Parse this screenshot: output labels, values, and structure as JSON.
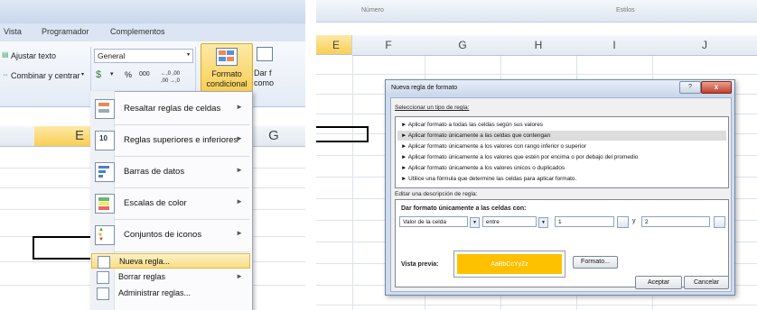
{
  "left": {
    "tabs": [
      "Vista",
      "Programador",
      "Complementos"
    ],
    "ribbon": {
      "wrap_text": "Ajustar texto",
      "merge_center": "Combinar y centrar",
      "number_format": "General",
      "percent": "%",
      "thousands": "000",
      "dec_inc": "←,0 ,00",
      "dec_dec": ",00 →,0",
      "conditional_format": [
        "Formato",
        "condicional"
      ],
      "format_as_table_partial": [
        "Dar f",
        "como"
      ]
    },
    "columns": [
      "E",
      "G"
    ],
    "menu": {
      "items": [
        {
          "label": "Resaltar reglas de celdas",
          "icon": "highlight-cells-rules-icon",
          "submenu": true
        },
        {
          "label": "Reglas superiores e inferiores",
          "icon": "top-bottom-rules-icon",
          "submenu": true
        },
        {
          "label": "Barras de datos",
          "icon": "data-bars-icon",
          "submenu": true
        },
        {
          "label": "Escalas de color",
          "icon": "color-scales-icon",
          "submenu": true
        },
        {
          "label": "Conjuntos de iconos",
          "icon": "icon-sets-icon",
          "submenu": true
        }
      ],
      "small_items": [
        {
          "label": "Nueva regla...",
          "icon": "new-rule-icon",
          "submenu": false
        },
        {
          "label": "Borrar reglas",
          "icon": "clear-rules-icon",
          "submenu": true
        },
        {
          "label": "Administrar reglas...",
          "icon": "manage-rules-icon",
          "submenu": false
        }
      ]
    }
  },
  "right": {
    "top_labels": [
      "Número",
      "Estilos"
    ],
    "columns": [
      "E",
      "F",
      "G",
      "H",
      "I",
      "J"
    ],
    "dialog": {
      "title": "Nueva regla de formato",
      "select_type_label": "Seleccionar un tipo de regla:",
      "rule_types": [
        "► Aplicar formato a todas las celdas según sus valores",
        "► Aplicar formato únicamente a las celdas que contengan",
        "► Aplicar formato únicamente a los valores con rango inferior o superior",
        "► Aplicar formato únicamente a los valores que estén por encima o por debajo del promedio",
        "► Aplicar formato únicamente a los valores únicos o duplicados",
        "► Utilice una fórmula que determine las celdas para aplicar formato."
      ],
      "selected_rule_index": 1,
      "edit_desc_label": "Editar una descripción de regla:",
      "format_only_label": "Dar formato únicamente a las celdas con:",
      "condition_field": "Valor de la celda",
      "operator_field": "entre",
      "value1": "1",
      "and_label": "y",
      "value2": "2",
      "preview_label": "Vista previa:",
      "preview_text": "AaBbCcYyZz",
      "preview_color": "#ffc000",
      "format_button": "Formato...",
      "ok_button": "Aceptar",
      "cancel_button": "Cancelar",
      "help_button": "?",
      "close_button": "x"
    }
  }
}
